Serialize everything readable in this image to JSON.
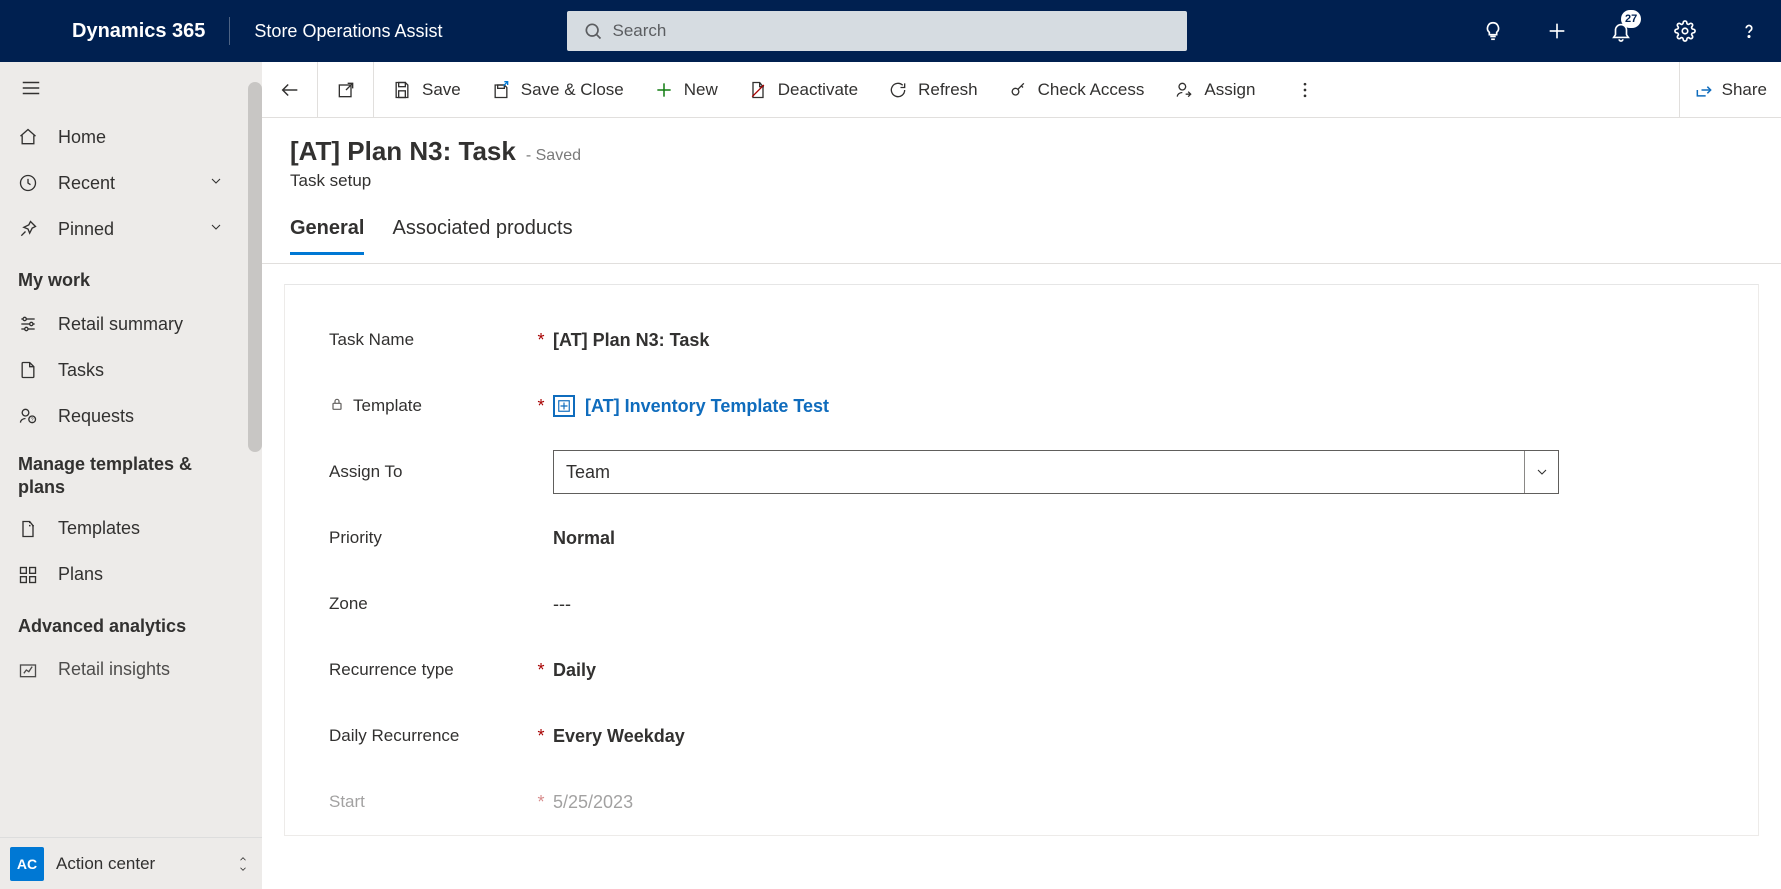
{
  "header": {
    "brand": "Dynamics 365",
    "app_name": "Store Operations Assist",
    "search_placeholder": "Search",
    "notifications_badge": "27"
  },
  "sidebar": {
    "home": "Home",
    "recent": "Recent",
    "pinned": "Pinned",
    "group_mywork": "My work",
    "retail_summary": "Retail summary",
    "tasks": "Tasks",
    "requests": "Requests",
    "group_manage": "Manage templates & plans",
    "templates": "Templates",
    "plans": "Plans",
    "group_analytics": "Advanced analytics",
    "retail_insights": "Retail insights",
    "switcher_initials": "AC",
    "switcher_label": "Action center"
  },
  "commands": {
    "save": "Save",
    "save_close": "Save & Close",
    "new": "New",
    "deactivate": "Deactivate",
    "refresh": "Refresh",
    "check_access": "Check Access",
    "assign": "Assign",
    "share": "Share"
  },
  "page": {
    "title": "[AT] Plan N3: Task",
    "saved_suffix": "- Saved",
    "subtitle": "Task setup",
    "tabs": {
      "general": "General",
      "associated": "Associated products"
    }
  },
  "form": {
    "task_name": {
      "label": "Task Name",
      "value": "[AT] Plan N3: Task",
      "required": true
    },
    "template": {
      "label": "Template",
      "value": "[AT] Inventory Template Test",
      "required": true,
      "locked": true
    },
    "assign_to": {
      "label": "Assign To",
      "value": "Team",
      "required": false
    },
    "priority": {
      "label": "Priority",
      "value": "Normal",
      "required": false
    },
    "zone": {
      "label": "Zone",
      "value": "---",
      "required": false
    },
    "recurrence_type": {
      "label": "Recurrence type",
      "value": "Daily",
      "required": true
    },
    "daily_recurrence": {
      "label": "Daily Recurrence",
      "value": "Every Weekday",
      "required": true
    },
    "start": {
      "label": "Start",
      "value": "5/25/2023",
      "required": true
    }
  }
}
